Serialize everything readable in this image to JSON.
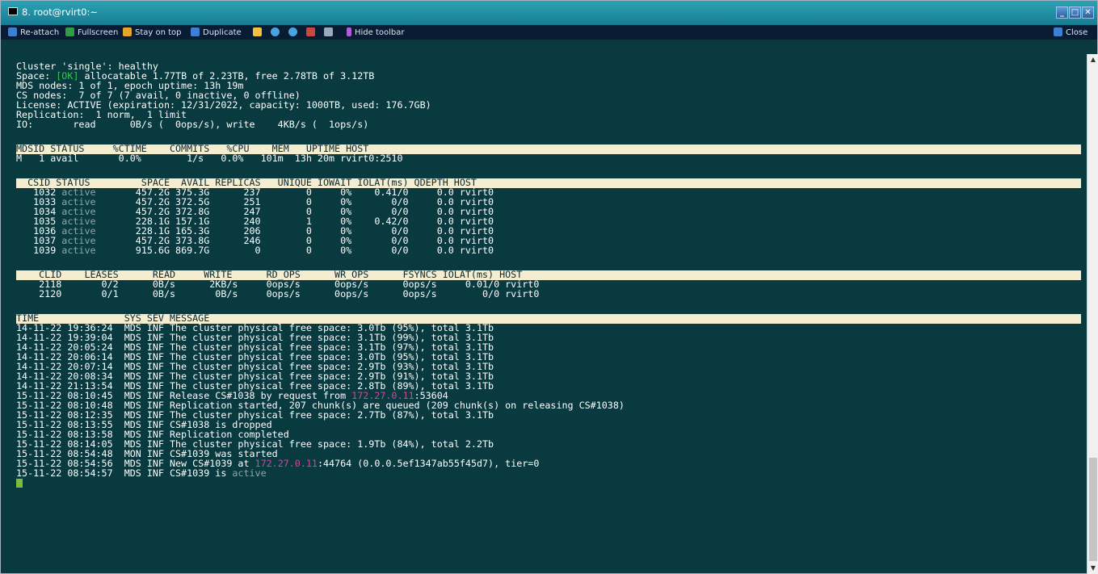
{
  "window": {
    "title": "8. root@rvirt0:~"
  },
  "toolbar": {
    "reattach": "Re-attach",
    "fullscreen": "Fullscreen",
    "stay_on_top": "Stay on top",
    "duplicate": "Duplicate",
    "hide_toolbar": "Hide toolbar",
    "close": "Close"
  },
  "summary": {
    "cluster": "Cluster 'single': healthy",
    "space_prefix": "Space: ",
    "space_ok": "[OK]",
    "space_rest": " allocatable 1.77TB of 2.23TB, free 2.78TB of 3.12TB",
    "mds": "MDS nodes: 1 of 1, epoch uptime: 13h 19m",
    "cs": "CS nodes:  7 of 7 (7 avail, 0 inactive, 0 offline)",
    "license": "License: ACTIVE (expiration: 12/31/2022, capacity: 1000TB, used: 176.7GB)",
    "replication": "Replication:  1 norm,  1 limit",
    "io": "IO:       read      0B/s (  0ops/s), write    4KB/s (  1ops/s)"
  },
  "mds_table": {
    "header": "MDSID STATUS     %CTIME    COMMITS   %CPU    MEM   UPTIME HOST",
    "rows": [
      "M   1 avail       0.0%        1/s   0.0%   101m  13h 20m rvirt0:2510"
    ]
  },
  "cs_table": {
    "header": "  CSID STATUS         SPACE  AVAIL REPLICAS   UNIQUE IOWAIT IOLAT(ms) QDEPTH HOST",
    "rows": [
      {
        "id": "   1032 ",
        "status": "active",
        "rest": "       457.2G 375.3G      237        0     0%    0.41/0     0.0 rvirt0"
      },
      {
        "id": "   1033 ",
        "status": "active",
        "rest": "       457.2G 372.5G      251        0     0%       0/0     0.0 rvirt0"
      },
      {
        "id": "   1034 ",
        "status": "active",
        "rest": "       457.2G 372.8G      247        0     0%       0/0     0.0 rvirt0"
      },
      {
        "id": "   1035 ",
        "status": "active",
        "rest": "       228.1G 157.1G      240        1     0%    0.42/0     0.0 rvirt0"
      },
      {
        "id": "   1036 ",
        "status": "active",
        "rest": "       228.1G 165.3G      206        0     0%       0/0     0.0 rvirt0"
      },
      {
        "id": "   1037 ",
        "status": "active",
        "rest": "       457.2G 373.8G      246        0     0%       0/0     0.0 rvirt0"
      },
      {
        "id": "   1039 ",
        "status": "active",
        "rest": "       915.6G 869.7G        0        0     0%       0/0     0.0 rvirt0"
      }
    ]
  },
  "client_table": {
    "header": "    CLID    LEASES      READ     WRITE      RD_OPS      WR_OPS      FSYNCS IOLAT(ms) HOST",
    "rows": [
      "    2118       0/2      0B/s      2KB/s     0ops/s      0ops/s      0ops/s     0.01/0 rvirt0",
      "    2120       0/1      0B/s       0B/s     0ops/s      0ops/s      0ops/s        0/0 rvirt0"
    ]
  },
  "log": {
    "header": "TIME               SYS SEV MESSAGE",
    "rows": [
      {
        "a": "14-11-22 19:36:24  MDS INF The cluster physical free space: 3.0Tb (95%), total 3.1Tb"
      },
      {
        "a": "14-11-22 19:39:04  MDS INF The cluster physical free space: 3.1Tb (99%), total 3.1Tb"
      },
      {
        "a": "14-11-22 20:05:24  MDS INF The cluster physical free space: 3.1Tb (97%), total 3.1Tb"
      },
      {
        "a": "14-11-22 20:06:14  MDS INF The cluster physical free space: 3.0Tb (95%), total 3.1Tb"
      },
      {
        "a": "14-11-22 20:07:14  MDS INF The cluster physical free space: 2.9Tb (93%), total 3.1Tb"
      },
      {
        "a": "14-11-22 20:08:34  MDS INF The cluster physical free space: 2.9Tb (91%), total 3.1Tb"
      },
      {
        "a": "14-11-22 21:13:54  MDS INF The cluster physical free space: 2.8Tb (89%), total 3.1Tb"
      },
      {
        "a": "15-11-22 08:10:45  MDS INF Release CS#1038 by request from ",
        "ip": "172.27.0.11",
        "b": ":53604"
      },
      {
        "a": "15-11-22 08:10:48  MDS INF Replication started, 207 chunk(s) are queued (209 chunk(s) on releasing CS#1038)"
      },
      {
        "a": "15-11-22 08:12:35  MDS INF The cluster physical free space: 2.7Tb (87%), total 3.1Tb"
      },
      {
        "a": "15-11-22 08:13:55  MDS INF CS#1038 is dropped"
      },
      {
        "a": "15-11-22 08:13:58  MDS INF Replication completed"
      },
      {
        "a": "15-11-22 08:14:05  MDS INF The cluster physical free space: 1.9Tb (84%), total 2.2Tb"
      },
      {
        "a": "15-11-22 08:54:48  MON INF CS#1039 was started"
      },
      {
        "a": "15-11-22 08:54:56  MDS INF New CS#1039 at ",
        "ip": "172.27.0.11",
        "b": ":44764 (0.0.0.5ef1347ab55f45d7), tier=0"
      },
      {
        "a": "15-11-22 08:54:57  MDS INF CS#1039 is ",
        "dim": "active"
      }
    ]
  }
}
